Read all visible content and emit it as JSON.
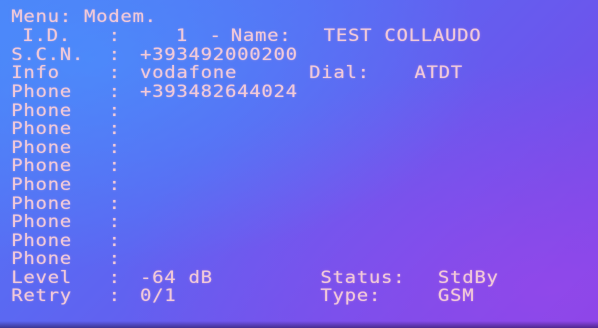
{
  "menu": {
    "title": "Menu: Modem."
  },
  "fields": {
    "id": {
      "label": "I.D.",
      "sep": ":",
      "value": "1",
      "dash": "-"
    },
    "name": {
      "label": "Name:",
      "value": "TEST COLLAUDO"
    },
    "scn": {
      "label": "S.C.N.",
      "sep": ":",
      "value": "+393492000200"
    },
    "info": {
      "label": "Info",
      "sep": ":",
      "value": "vodafone"
    },
    "dial": {
      "label": "Dial:",
      "value": "ATDT"
    }
  },
  "phones": [
    {
      "label": "Phone",
      "sep": ":",
      "value": "+393482644024"
    },
    {
      "label": "Phone",
      "sep": ":",
      "value": ""
    },
    {
      "label": "Phone",
      "sep": ":",
      "value": ""
    },
    {
      "label": "Phone",
      "sep": ":",
      "value": ""
    },
    {
      "label": "Phone",
      "sep": ":",
      "value": ""
    },
    {
      "label": "Phone",
      "sep": ":",
      "value": ""
    },
    {
      "label": "Phone",
      "sep": ":",
      "value": ""
    },
    {
      "label": "Phone",
      "sep": ":",
      "value": ""
    },
    {
      "label": "Phone",
      "sep": ":",
      "value": ""
    },
    {
      "label": "Phone",
      "sep": ":",
      "value": ""
    }
  ],
  "level": {
    "label": "Level",
    "sep": ":",
    "value": "-64 dB"
  },
  "status": {
    "label": "Status:",
    "value": "StdBy"
  },
  "retry": {
    "label": "Retry",
    "sep": ":",
    "value": "0/1"
  },
  "type": {
    "label": "Type:",
    "value": "GSM"
  },
  "colors": {
    "text": "#f2c9d8",
    "background_top_left": "#4f7df6",
    "background_bottom_right": "#7c46e6"
  }
}
